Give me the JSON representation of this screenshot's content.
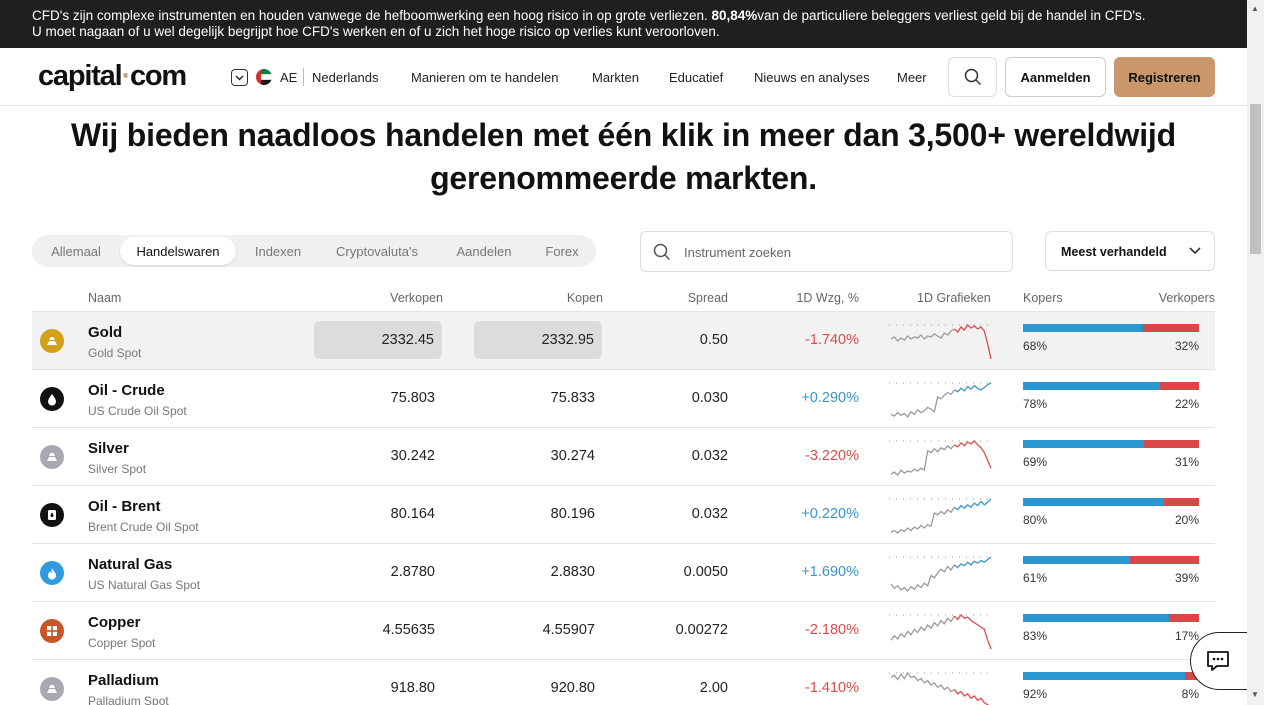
{
  "risk_banner": {
    "text_before": "CFD's zijn complexe instrumenten en houden vanwege de hefboomwerking een hoog risico in op grote verliezen. ",
    "percentage": "80,84%",
    "text_after": "van de particuliere beleggers verliest geld bij de handel in CFD's.",
    "line2": "U moet nagaan of u wel degelijk begrijpt hoe CFD's werken en of u zich het hoge risico op verlies kunt veroorloven."
  },
  "header": {
    "logo_left": "capital",
    "logo_dot": "·",
    "logo_right": "com",
    "region_code": "AE",
    "language": "Nederlands",
    "nav": [
      "Manieren om te handelen",
      "Markten",
      "Educatief",
      "Nieuws en analyses",
      "Meer"
    ],
    "login_label": "Aanmelden",
    "register_label": "Registreren"
  },
  "headline": "Wij bieden naadloos handelen met één klik in meer dan 3,500+ wereldwijd gerenommeerde markten.",
  "tabs": [
    "Allemaal",
    "Handelswaren",
    "Indexen",
    "Cryptovaluta's",
    "Aandelen",
    "Forex"
  ],
  "active_tab": "Handelswaren",
  "search": {
    "placeholder": "Instrument zoeken"
  },
  "sort": {
    "selected": "Meest verhandeld"
  },
  "table": {
    "columns": {
      "name": "Naam",
      "sell": "Verkopen",
      "buy": "Kopen",
      "spread": "Spread",
      "change": "1D Wzg, %",
      "chart": "1D Grafieken",
      "buyers": "Kopers",
      "sellers": "Verkopers"
    },
    "rows": [
      {
        "name": "Gold",
        "sub": "Gold Spot",
        "sell": "2332.45",
        "buy": "2332.95",
        "spread": "0.50",
        "change": "-1.740%",
        "dir": "neg",
        "buyers": "68%",
        "sellers": "32%",
        "buyers_value": 68,
        "icon": "gold-bars-icon",
        "icon_color": "#d4a017",
        "spark": [
          50,
          52,
          48,
          51,
          49,
          53,
          50,
          52,
          51,
          54,
          50,
          53,
          52,
          55,
          53,
          51,
          56,
          54,
          58,
          60,
          57,
          62,
          59,
          64,
          61,
          63,
          60,
          62,
          58,
          45,
          30
        ]
      },
      {
        "name": "Oil - Crude",
        "sub": "US Crude Oil Spot",
        "sell": "75.803",
        "buy": "75.833",
        "spread": "0.030",
        "change": "+0.290%",
        "dir": "pos",
        "buyers": "78%",
        "sellers": "22%",
        "buyers_value": 78,
        "icon": "oil-drop-icon",
        "icon_color": "#111111",
        "spark": [
          30,
          28,
          32,
          29,
          31,
          27,
          33,
          30,
          35,
          32,
          34,
          38,
          36,
          33,
          50,
          48,
          52,
          55,
          53,
          58,
          56,
          60,
          57,
          62,
          59,
          63,
          60,
          58,
          61,
          64,
          66
        ]
      },
      {
        "name": "Silver",
        "sub": "Silver Spot",
        "sell": "30.242",
        "buy": "30.274",
        "spread": "0.032",
        "change": "-3.220%",
        "dir": "neg",
        "buyers": "69%",
        "sellers": "31%",
        "buyers_value": 69,
        "icon": "silver-bars-icon",
        "icon_color": "#a9a9b3",
        "spark": [
          28,
          30,
          27,
          32,
          29,
          31,
          30,
          33,
          31,
          34,
          32,
          52,
          50,
          54,
          51,
          55,
          53,
          57,
          54,
          58,
          56,
          60,
          57,
          61,
          59,
          62,
          58,
          55,
          50,
          42,
          34
        ]
      },
      {
        "name": "Oil - Brent",
        "sub": "Brent Crude Oil Spot",
        "sell": "80.164",
        "buy": "80.196",
        "spread": "0.032",
        "change": "+0.220%",
        "dir": "pos",
        "buyers": "80%",
        "sellers": "20%",
        "buyers_value": 80,
        "icon": "oil-barrel-icon",
        "icon_color": "#111111",
        "spark": [
          25,
          27,
          24,
          28,
          26,
          30,
          27,
          31,
          29,
          33,
          30,
          34,
          32,
          48,
          46,
          50,
          47,
          52,
          49,
          55,
          52,
          57,
          54,
          58,
          55,
          60,
          57,
          62,
          58,
          61,
          65
        ]
      },
      {
        "name": "Natural Gas",
        "sub": "US Natural Gas Spot",
        "sell": "2.8780",
        "buy": "2.8830",
        "spread": "0.0050",
        "change": "+1.690%",
        "dir": "pos",
        "buyers": "61%",
        "sellers": "39%",
        "buyers_value": 61,
        "icon": "flame-icon",
        "icon_color": "#2f9be0",
        "spark": [
          35,
          30,
          33,
          28,
          31,
          27,
          32,
          29,
          34,
          31,
          36,
          33,
          45,
          42,
          48,
          52,
          49,
          55,
          51,
          57,
          54,
          58,
          56,
          60,
          57,
          61,
          59,
          62,
          60,
          63,
          66
        ]
      },
      {
        "name": "Copper",
        "sub": "Copper Spot",
        "sell": "4.55635",
        "buy": "4.55907",
        "spread": "0.00272",
        "change": "-2.180%",
        "dir": "neg",
        "buyers": "83%",
        "sellers": "17%",
        "buyers_value": 83,
        "icon": "copper-blocks-icon",
        "icon_color": "#c8552a",
        "spark": [
          40,
          44,
          41,
          46,
          43,
          48,
          45,
          50,
          47,
          52,
          49,
          54,
          51,
          56,
          53,
          58,
          55,
          60,
          57,
          62,
          59,
          63,
          60,
          61,
          58,
          56,
          54,
          52,
          50,
          40,
          32
        ]
      },
      {
        "name": "Palladium",
        "sub": "Palladium Spot",
        "sell": "918.80",
        "buy": "920.80",
        "spread": "2.00",
        "change": "-1.410%",
        "dir": "neg",
        "buyers": "92%",
        "sellers": "8%",
        "buyers_value": 92,
        "icon": "palladium-bars-icon",
        "icon_color": "#a9a9b3",
        "spark": [
          60,
          62,
          58,
          63,
          59,
          64,
          60,
          61,
          57,
          59,
          55,
          57,
          53,
          55,
          51,
          53,
          49,
          51,
          47,
          49,
          45,
          47,
          43,
          45,
          41,
          43,
          39,
          41,
          37,
          35,
          33
        ]
      }
    ]
  },
  "colors": {
    "brand_accent": "#c9976a",
    "negative": "#e04a4a",
    "positive": "#3b95c9",
    "buyers_bar": "#2a97d1",
    "sellers_bar": "#d94848"
  }
}
